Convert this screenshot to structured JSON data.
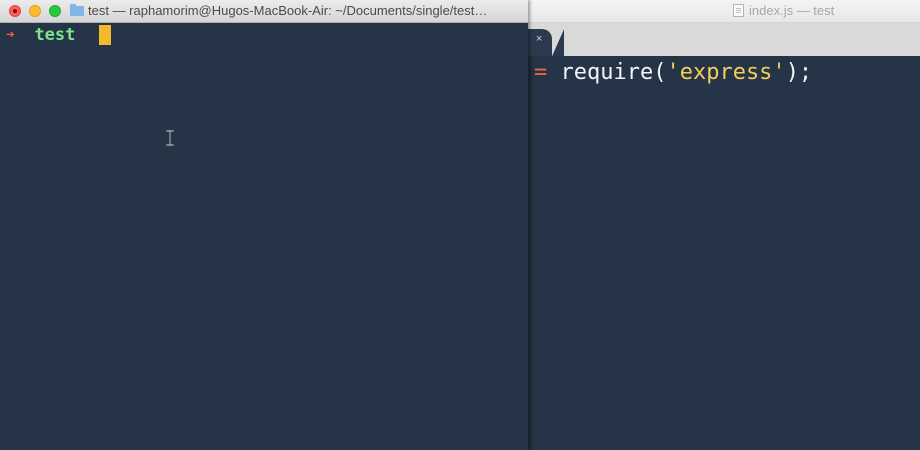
{
  "terminal": {
    "title": "test — raphamorim@Hugos-MacBook-Air: ~/Documents/single/test…",
    "prompt_symbol": "➜",
    "prompt_dir": "test"
  },
  "editor": {
    "title": "index.js — test",
    "tab_close": "×",
    "code": {
      "operator": "=",
      "func": "require(",
      "string": "'express'",
      "tail": ");"
    }
  },
  "colors": {
    "background": "#253447",
    "prompt_arrow": "#f0634a",
    "prompt_dir": "#7de58a",
    "cursor": "#f4b82d",
    "string": "#f4cd5a"
  },
  "icons": [
    "close-traffic-light-icon",
    "minimize-traffic-light-icon",
    "maximize-traffic-light-icon",
    "folder-icon",
    "document-icon",
    "tab-close-icon",
    "text-cursor-icon"
  ]
}
